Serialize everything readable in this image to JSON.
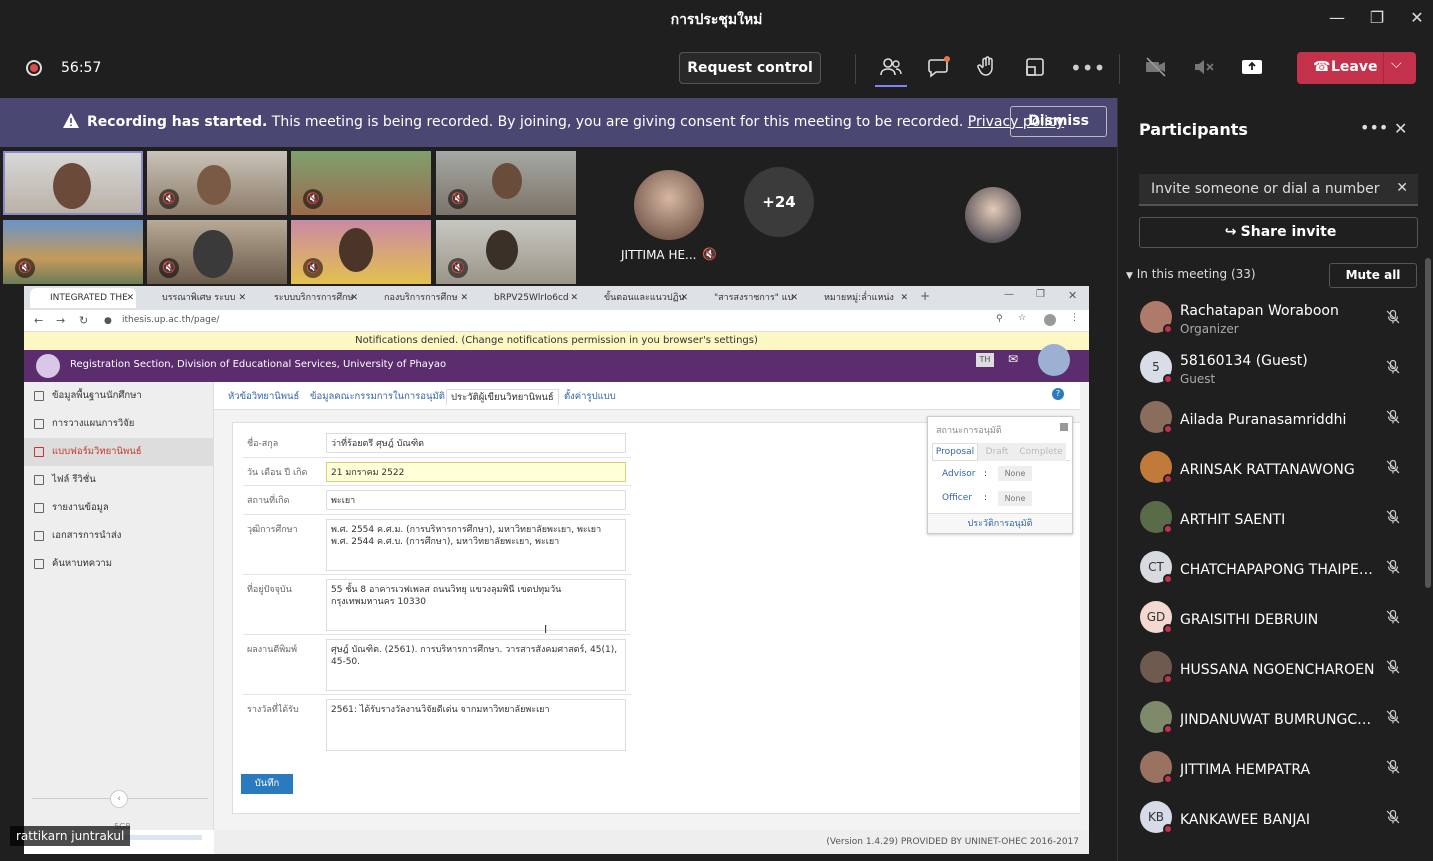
{
  "window": {
    "title": "การประชุมใหม่"
  },
  "toolbar": {
    "timer": "56:57",
    "request_control": "Request control",
    "leave": "Leave"
  },
  "banner": {
    "bold": "Recording has started.",
    "text": " This meeting is being recorded. By joining, you are giving consent for this meeting to be recorded. ",
    "link": "Privacy policy",
    "dismiss": "Dismiss"
  },
  "videos": {
    "featured_name": "JITTIMA HE...",
    "more_count": "+24"
  },
  "shared": {
    "presenter": "rattikarn juntrakul",
    "browser_tabs": [
      "INTEGRATED THE",
      "บรรณาพิเศษ ระบบ",
      "ระบบบริการการศึกษ",
      "กองบริการการศึกษ",
      "bRPV25WlrIo6cd",
      "ขั้นตอนและแนวปฏิบ",
      "\"สารสงราชการ\" แบ",
      "หมายหมู่:ล่ำแหน่ง"
    ],
    "url": "ithesis.up.ac.th/page/",
    "notification": "Notifications denied. (Change notifications permission in you browser's settings)",
    "university": "Registration Section, Division of Educational Services, University of Phayao",
    "lang": "TH",
    "sidebar": [
      "ข้อมูลพื้นฐานนักศึกษา",
      "การวางแผนการวิจัย",
      "แบบฟอร์มวิทยานิพนธ์",
      "ไฟล์ รีวิชั่น",
      "รายงานข้อมูล",
      "เอกสารการนำส่ง",
      "ค้นหาบทความ"
    ],
    "content_tabs": [
      "หัวข้อวิทยานิพนธ์",
      "ข้อมูลคณะกรรมการในการอนุมัติ",
      "ประวัติผู้เขียนวิทยานิพนธ์",
      "ตั้งค่ารูปแบบ"
    ],
    "form": [
      {
        "label": "ชื่อ-สกุล",
        "value": "ว่าที่ร้อยตรี ศุษฎ์ บัณฑิต"
      },
      {
        "label": "วัน เดือน ปี เกิด",
        "value": "21 มกราคม 2522"
      },
      {
        "label": "สถานที่เกิด",
        "value": "พะเยา"
      },
      {
        "label": "วุฒิการศึกษา",
        "value": "พ.ศ. 2554 ค.ศ.ม. (การบริหารการศึกษา), มหาวิทยาลัยพะเยา, พะเยา\nพ.ศ. 2544 ค.ศ.บ. (การศึกษา), มหาวิทยาลัยพะเยา, พะเยา"
      },
      {
        "label": "ที่อยู่ปัจจุบัน",
        "value": "55 ชั้น 8 อาคารเวฟเพลส ถนนวิทยุ แขวงลุมพินี เขตปทุมวัน\nกรุงเทพมหานคร 10330"
      },
      {
        "label": "ผลงานตีพิมพ์",
        "value": "ศุษฎ์ บัณฑิต. (2561). การบริหารการศึกษา. วารสารสังคมศาสตร์, 45(1),\n45-50."
      },
      {
        "label": "รางวัลที่ได้รับ",
        "value": "2561: ได้รับรางวัลงานวิจัยดีเด่น จากมหาวิทยาลัยพะเยา"
      }
    ],
    "save": "บันทึก",
    "status": {
      "title": "สถานะการอนุมัติ",
      "tabs": [
        "Proposal",
        "Draft",
        "Complete"
      ],
      "advisor_label": "Advisor",
      "advisor_value": "None",
      "officer_label": "Officer",
      "officer_value": "None",
      "history": "ประวัติการอนุมัติ"
    },
    "footer": "(Version 1.4.29) PROVIDED BY UNINET-OHEC 2016-2017",
    "storage": "5GB"
  },
  "participants": {
    "title": "Participants",
    "invite_placeholder": "Invite someone or dial a number",
    "share_invite": "Share invite",
    "in_meeting": "In this meeting (33)",
    "mute_all": "Mute all",
    "list": [
      {
        "name": "Rachatapan Woraboon",
        "role": "Organizer",
        "initials": "",
        "color": "#b07a6a"
      },
      {
        "name": "58160134 (Guest)",
        "role": "Guest",
        "initials": "5",
        "color": "#d9dde8"
      },
      {
        "name": "Ailada Puranasamriddhi",
        "role": "",
        "initials": "",
        "color": "#8a6d5c"
      },
      {
        "name": "ARINSAK RATTANAWONG",
        "role": "",
        "initials": "",
        "color": "#c27a3a"
      },
      {
        "name": "ARTHIT SAENTI",
        "role": "",
        "initials": "",
        "color": "#5a6b4a"
      },
      {
        "name": "CHATCHAPAPONG THAIPETK...",
        "role": "",
        "initials": "CT",
        "color": "#d7dbe0"
      },
      {
        "name": "GRAISITHI DEBRUIN",
        "role": "",
        "initials": "GD",
        "color": "#f3d9cf"
      },
      {
        "name": "HUSSANA NGOENCHAROEN",
        "role": "",
        "initials": "",
        "color": "#6e5a4e"
      },
      {
        "name": "JINDANUWAT BUMRUNGCH...",
        "role": "",
        "initials": "",
        "color": "#7e8a6a"
      },
      {
        "name": "JITTIMA HEMPATRA",
        "role": "",
        "initials": "",
        "color": "#9a7260"
      },
      {
        "name": "KANKAWEE BANJAI",
        "role": "",
        "initials": "KB",
        "color": "#d7dbe8"
      }
    ]
  }
}
